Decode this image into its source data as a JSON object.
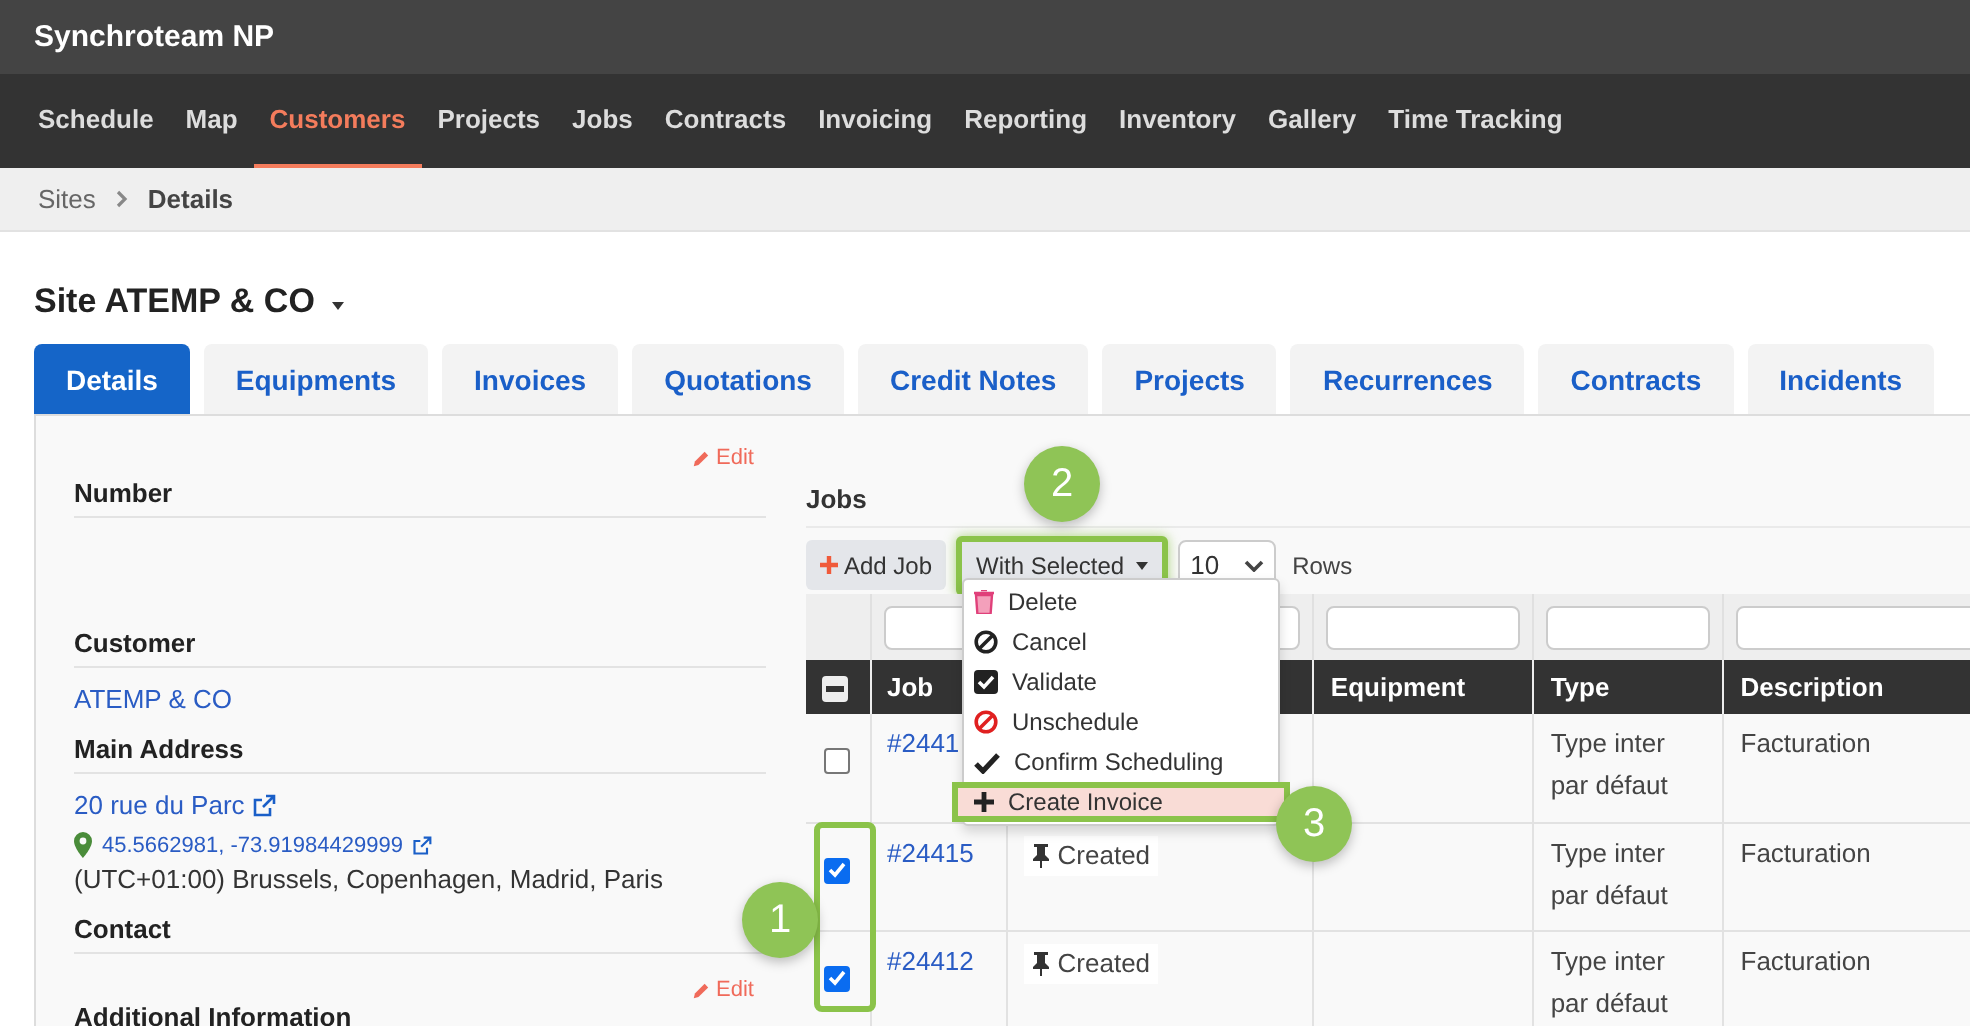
{
  "app": {
    "title": "Synchroteam NP"
  },
  "nav": [
    {
      "label": "Schedule",
      "selected": false
    },
    {
      "label": "Map",
      "selected": false
    },
    {
      "label": "Customers",
      "selected": true
    },
    {
      "label": "Projects",
      "selected": false
    },
    {
      "label": "Jobs",
      "selected": false
    },
    {
      "label": "Contracts",
      "selected": false
    },
    {
      "label": "Invoicing",
      "selected": false
    },
    {
      "label": "Reporting",
      "selected": false
    },
    {
      "label": "Inventory",
      "selected": false
    },
    {
      "label": "Gallery",
      "selected": false
    },
    {
      "label": "Time Tracking",
      "selected": false
    }
  ],
  "breadcrumb": [
    "Sites",
    "Details"
  ],
  "page_title": "Site ATEMP & CO",
  "tabs": [
    {
      "label": "Details",
      "selected": true
    },
    {
      "label": "Equipments",
      "selected": false
    },
    {
      "label": "Invoices",
      "selected": false
    },
    {
      "label": "Quotations",
      "selected": false
    },
    {
      "label": "Credit Notes",
      "selected": false
    },
    {
      "label": "Projects",
      "selected": false
    },
    {
      "label": "Recurrences",
      "selected": false
    },
    {
      "label": "Contracts",
      "selected": false
    },
    {
      "label": "Incidents",
      "selected": false
    }
  ],
  "details": {
    "edit": "Edit",
    "sections": [
      {
        "kind": "empty",
        "label": "Number"
      },
      {
        "kind": "link",
        "label": "Customer",
        "value": "ATEMP & CO"
      },
      {
        "kind": "address",
        "label": "Main Address",
        "address": "20 rue du Parc",
        "coordinates": "45.5662981, -73.91984429999",
        "timezone": "(UTC+01:00) Brussels, Copenhagen, Madrid, Paris"
      },
      {
        "kind": "empty",
        "label": "Contact"
      },
      {
        "kind": "editable",
        "label": "Additional Information",
        "edit": "Edit"
      }
    ]
  },
  "jobs": {
    "title": "Jobs",
    "add_button": "Add Job",
    "with_selected": {
      "label": "With Selected",
      "highlighted": true
    },
    "page_size": "10",
    "rows_label": "Rows",
    "select_all_indeterminate": true,
    "columns": [
      {
        "label": "Job"
      },
      {},
      {
        "label": "Equipment"
      },
      {
        "label": "Type"
      },
      {
        "label": "Description"
      }
    ],
    "rows": [
      {
        "checked": false,
        "job": "#2441",
        "type": "Type inter par défaut",
        "description": "Facturation"
      },
      {
        "checked": true,
        "job": "#24415",
        "status": "Created",
        "type": "Type inter par défaut",
        "description": "Facturation"
      },
      {
        "checked": true,
        "job": "#24412",
        "status": "Created",
        "type": "Type inter par défaut",
        "description": "Facturation"
      }
    ],
    "menu": [
      {
        "kind": "delete",
        "label": "Delete",
        "highlighted": false
      },
      {
        "kind": "cancel",
        "label": "Cancel",
        "highlighted": false
      },
      {
        "kind": "validate",
        "label": "Validate",
        "highlighted": false
      },
      {
        "kind": "unschedule",
        "label": "Unschedule",
        "highlighted": false
      },
      {
        "kind": "confirm",
        "label": "Confirm Scheduling",
        "highlighted": false
      },
      {
        "kind": "invoice",
        "label": "Create Invoice",
        "highlighted": true
      }
    ]
  },
  "annotations": [
    {
      "label": "1"
    },
    {
      "label": "2"
    },
    {
      "label": "3"
    }
  ]
}
